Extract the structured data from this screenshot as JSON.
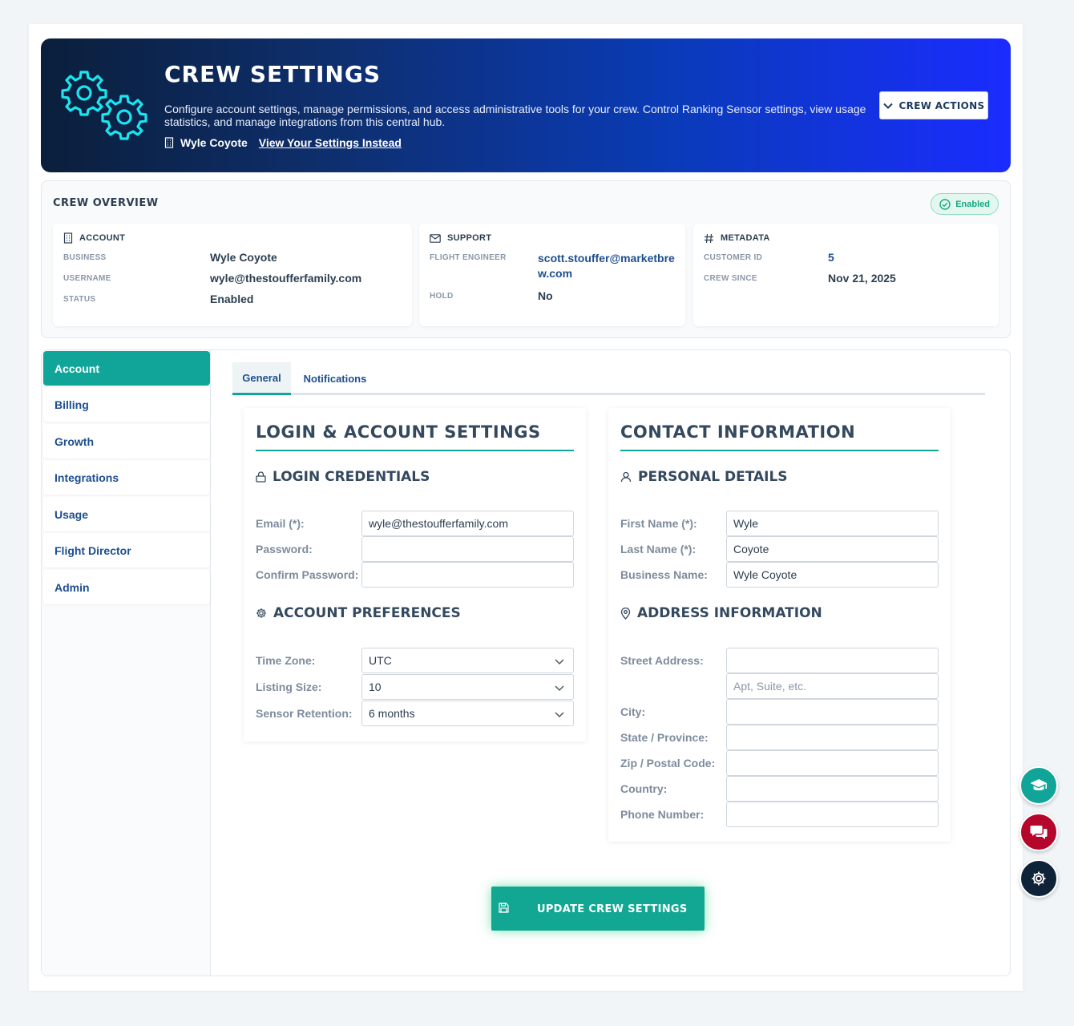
{
  "header": {
    "title": "CREW SETTINGS",
    "description": "Configure account settings, manage permissions, and access administrative tools for your crew. Control Ranking Sensor settings, view usage statistics, and manage integrations from this central hub.",
    "crew_name": "Wyle Coyote",
    "view_link": "View Your Settings Instead",
    "actions_label": "CREW ACTIONS"
  },
  "overview": {
    "title": "CREW OVERVIEW",
    "status": "Enabled",
    "account": {
      "heading": "ACCOUNT",
      "business_label": "BUSINESS",
      "business": "Wyle Coyote",
      "username_label": "USERNAME",
      "username": "wyle@thestoufferfamily.com",
      "status_label": "STATUS",
      "status": "Enabled"
    },
    "support": {
      "heading": "SUPPORT",
      "engineer_label": "FLIGHT ENGINEER",
      "engineer_line1": "scott.stouffer@marketbre",
      "engineer_line2": "w.com",
      "hold_label": "HOLD",
      "hold": "No"
    },
    "metadata": {
      "heading": "METADATA",
      "customer_id_label": "CUSTOMER ID",
      "customer_id": "5",
      "crew_since_label": "CREW SINCE",
      "crew_since": "Nov 21, 2025"
    }
  },
  "sidebar": {
    "items": [
      {
        "label": "Account"
      },
      {
        "label": "Billing"
      },
      {
        "label": "Growth"
      },
      {
        "label": "Integrations"
      },
      {
        "label": "Usage"
      },
      {
        "label": "Flight Director"
      },
      {
        "label": "Admin"
      }
    ]
  },
  "tabs": [
    {
      "label": "General"
    },
    {
      "label": "Notifications"
    }
  ],
  "login_panel": {
    "title": "LOGIN & ACCOUNT SETTINGS",
    "credentials_heading": "LOGIN CREDENTIALS",
    "email_label": "Email (*):",
    "email_value": "wyle@thestoufferfamily.com",
    "password_label": "Password:",
    "confirm_label": "Confirm Password:",
    "prefs_heading": "ACCOUNT PREFERENCES",
    "timezone_label": "Time Zone:",
    "timezone_value": "UTC",
    "listing_label": "Listing Size:",
    "listing_value": "10",
    "retention_label": "Sensor Retention:",
    "retention_value": "6 months"
  },
  "contact_panel": {
    "title": "CONTACT INFORMATION",
    "personal_heading": "PERSONAL DETAILS",
    "first_label": "First Name (*):",
    "first_value": "Wyle",
    "last_label": "Last Name (*):",
    "last_value": "Coyote",
    "business_label": "Business Name:",
    "business_value": "Wyle Coyote",
    "address_heading": "ADDRESS INFORMATION",
    "street_label": "Street Address:",
    "apt_placeholder": "Apt, Suite, etc.",
    "city_label": "City:",
    "state_label": "State / Province:",
    "zip_label": "Zip / Postal Code:",
    "country_label": "Country:",
    "phone_label": "Phone Number:"
  },
  "update_button": "UPDATE CREW SETTINGS",
  "colors": {
    "accent": "#11a59a",
    "link": "#1d4e8f",
    "fab_chat": "#b5062b",
    "fab_settings": "#0f2338"
  },
  "fabs": [
    "graduation-cap-icon",
    "chat-icon",
    "gear-icon"
  ]
}
